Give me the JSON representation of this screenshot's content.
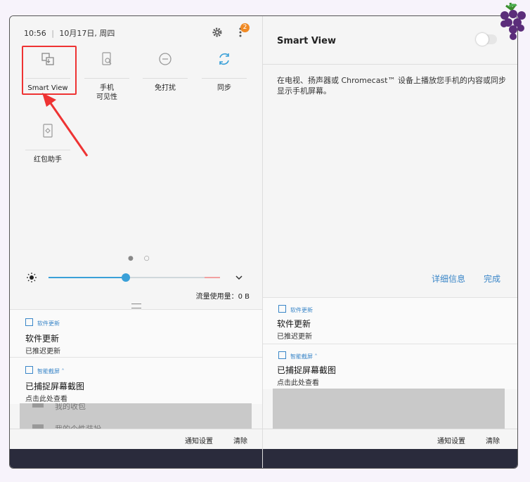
{
  "status": {
    "time": "10:56",
    "date": "10月17日, 周四",
    "badge_count": "2"
  },
  "quick_tiles": [
    {
      "label": "Smart View",
      "icon": "smart-view-icon"
    },
    {
      "label": "手机\n可见性",
      "icon": "phone-visibility-icon"
    },
    {
      "label": "免打扰",
      "icon": "do-not-disturb-icon"
    },
    {
      "label": "同步",
      "icon": "sync-icon"
    },
    {
      "label": "红包助手",
      "icon": "red-packet-icon"
    }
  ],
  "brightness": {
    "level": 0.45
  },
  "data_usage": "流量使用量：0 B",
  "notifications": [
    {
      "app": "软件更新",
      "title": "软件更新",
      "subtitle": "已推迟更新"
    },
    {
      "app": "智能截屏",
      "title": "已捕捉屏幕截图",
      "subtitle": "点击此处查看"
    }
  ],
  "background_list": [
    "我的收包",
    "我的个性装扮"
  ],
  "bottom_bar": {
    "settings": "通知设置",
    "clear": "清除"
  },
  "smart_view_panel": {
    "title": "Smart View",
    "description": "在电视、扬声器或 Chromecast™ 设备上播放您手机的内容或同步显示手机屏幕。",
    "details": "详细信息",
    "done": "完成"
  },
  "colors": {
    "accent": "#3a86c8",
    "annotation": "#e33333",
    "badge": "#f08a24"
  }
}
